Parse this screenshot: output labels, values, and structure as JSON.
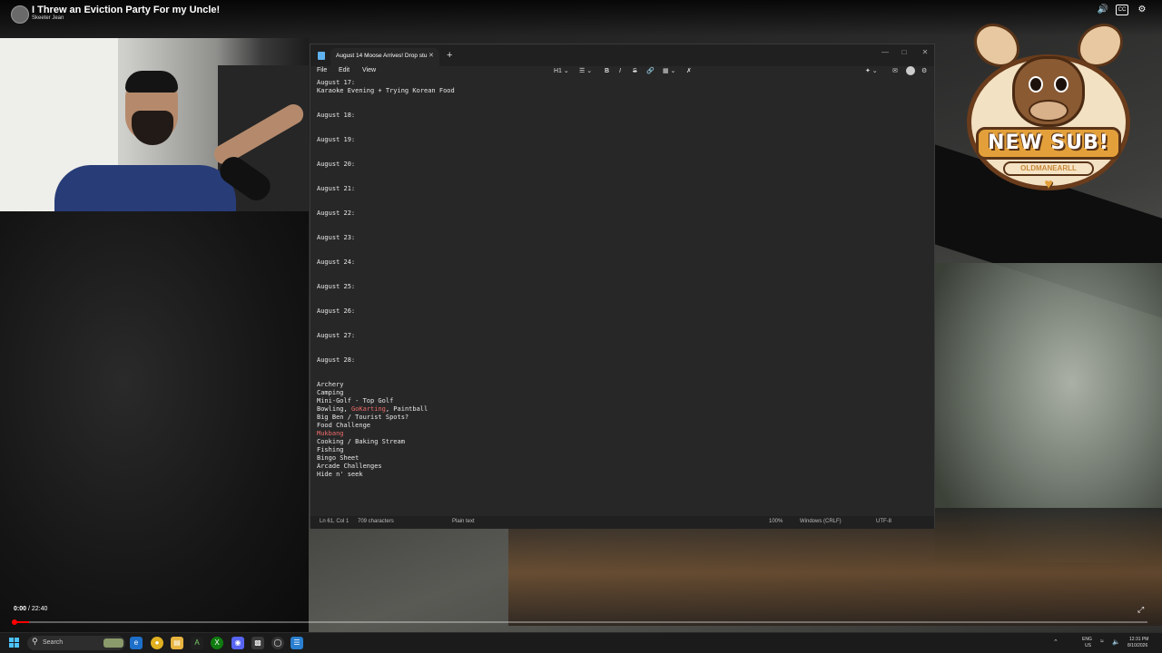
{
  "video": {
    "title": "I Threw an Eviction Party For my Uncle!",
    "channel": "Skeeter Jean",
    "time_current": "0:00",
    "time_total": "22:40",
    "time_separator": " / ",
    "progress_fraction": 0.013
  },
  "top_icons": [
    "volume-icon",
    "cc-icon",
    "settings-icon"
  ],
  "sub_alert": {
    "title": "NEW SUB!",
    "username": "OLDMANEARLL"
  },
  "notepad": {
    "tab_title": "August 14 Moose Arrives! Drop stu",
    "menu": [
      "File",
      "Edit",
      "View"
    ],
    "heading_control": "H1",
    "lines": [
      {
        "text": "August 17:",
        "red": []
      },
      {
        "text": "Karaoke Evening + Trying Korean Food",
        "red": []
      },
      {
        "text": "",
        "red": []
      },
      {
        "text": "",
        "red": []
      },
      {
        "text": "August 18:",
        "red": []
      },
      {
        "text": "",
        "red": []
      },
      {
        "text": "",
        "red": []
      },
      {
        "text": "August 19:",
        "red": []
      },
      {
        "text": "",
        "red": []
      },
      {
        "text": "",
        "red": []
      },
      {
        "text": "August 20:",
        "red": []
      },
      {
        "text": "",
        "red": []
      },
      {
        "text": "",
        "red": []
      },
      {
        "text": "August 21:",
        "red": []
      },
      {
        "text": "",
        "red": []
      },
      {
        "text": "",
        "red": []
      },
      {
        "text": "August 22:",
        "red": []
      },
      {
        "text": "",
        "red": []
      },
      {
        "text": "",
        "red": []
      },
      {
        "text": "August 23:",
        "red": []
      },
      {
        "text": "",
        "red": []
      },
      {
        "text": "",
        "red": []
      },
      {
        "text": "August 24:",
        "red": []
      },
      {
        "text": "",
        "red": []
      },
      {
        "text": "",
        "red": []
      },
      {
        "text": "August 25:",
        "red": []
      },
      {
        "text": "",
        "red": []
      },
      {
        "text": "",
        "red": []
      },
      {
        "text": "August 26:",
        "red": []
      },
      {
        "text": "",
        "red": []
      },
      {
        "text": "",
        "red": []
      },
      {
        "text": "August 27:",
        "red": []
      },
      {
        "text": "",
        "red": []
      },
      {
        "text": "",
        "red": []
      },
      {
        "text": "August 28:",
        "red": []
      },
      {
        "text": "",
        "red": []
      },
      {
        "text": "",
        "red": []
      },
      {
        "text": "Archery",
        "red": []
      },
      {
        "text": "Camping",
        "red": []
      },
      {
        "text": "Mini-Golf - Top Golf",
        "red": []
      },
      {
        "text": "Bowling, GoKarting, Paintball",
        "red": [
          "GoKarting"
        ]
      },
      {
        "text": "Big Ben / Tourist Spots?",
        "red": []
      },
      {
        "text": "Food Challenge",
        "red": []
      },
      {
        "text": "Mukbang",
        "red": [
          "Mukbang"
        ]
      },
      {
        "text": "Cooking / Baking Stream",
        "red": []
      },
      {
        "text": "Fishing",
        "red": []
      },
      {
        "text": "Bingo Sheet",
        "red": []
      },
      {
        "text": "Arcade Challenges",
        "red": []
      },
      {
        "text": "Hide n' seek",
        "red": []
      }
    ],
    "status": {
      "position": "Ln 61, Col 1",
      "characters": "709 characters",
      "format": "Plain text",
      "zoom": "100%",
      "line_ending": "Windows (CRLF)",
      "encoding": "UTF-8"
    }
  },
  "taskbar": {
    "search_label": "Search",
    "apps": [
      "widgets-icon",
      "edge-icon",
      "chrome-icon",
      "file-explorer-icon",
      "terminal-icon",
      "xbox-icon",
      "discord-icon",
      "xbox-game-bar-icon",
      "obs-icon",
      "notepad-icon"
    ],
    "language": "ENG",
    "region": "US",
    "time": "12:31 PM",
    "date": "8/10/2026"
  },
  "colors": {
    "accent_red": "#ff0000",
    "notepad_bg": "#272727",
    "spell_error": "#ee6b6b",
    "windows_blue": "#4cc2ff"
  }
}
